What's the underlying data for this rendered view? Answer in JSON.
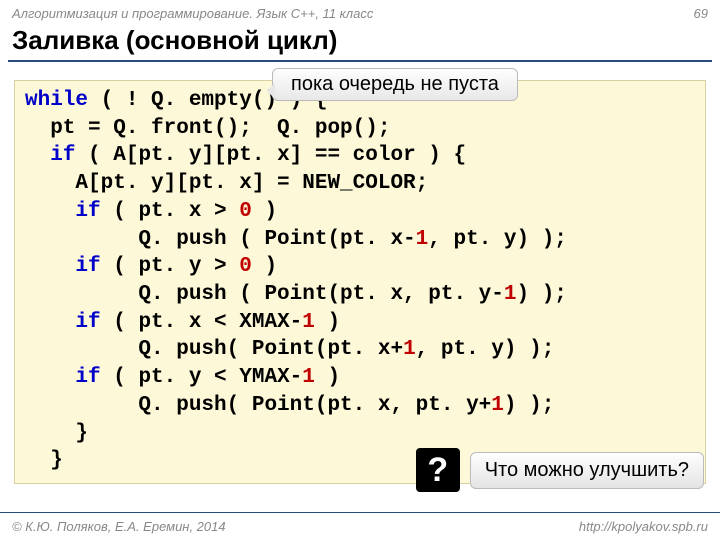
{
  "header": {
    "course": "Алгоритмизация и программирование. Язык C++, 11 класс",
    "slide_num": "69"
  },
  "title": "Заливка (основной цикл)",
  "callout": "пока очередь не пуста",
  "code": {
    "l1a": "while",
    "l1b": " ( ! Q. empty() ) {",
    "l2": "  pt = Q. front();  Q. pop();",
    "l3a": "  ",
    "l3b": "if",
    "l3c": " ( A[pt. y][pt. x] == color ) {",
    "l4": "    A[pt. y][pt. x] = NEW_COLOR;",
    "l5a": "    ",
    "l5b": "if",
    "l5c": " ( pt. x > ",
    "l5d": "0",
    "l5e": " )",
    "l6a": "         Q. push ( Point(pt. x-",
    "l6b": "1",
    "l6c": ", pt. y) );",
    "l7a": "    ",
    "l7b": "if",
    "l7c": " ( pt. y > ",
    "l7d": "0",
    "l7e": " )",
    "l8a": "         Q. push ( Point(pt. x, pt. y-",
    "l8b": "1",
    "l8c": ") );",
    "l9a": "    ",
    "l9b": "if",
    "l9c": " ( pt. x < XMAX-",
    "l9d": "1",
    "l9e": " )",
    "l10a": "         Q. push( Point(pt. x+",
    "l10b": "1",
    "l10c": ", pt. y) );",
    "l11a": "    ",
    "l11b": "if",
    "l11c": " ( pt. y < YMAX-",
    "l11d": "1",
    "l11e": " )",
    "l12a": "         Q. push( Point(pt. x, pt. y+",
    "l12b": "1",
    "l12c": ") );",
    "l13": "    }",
    "l14": "  }"
  },
  "question": {
    "mark": "?",
    "text": "Что можно улучшить?"
  },
  "footer": {
    "copyright": "© К.Ю. Поляков, Е.А. Еремин, 2014",
    "url": "http://kpolyakov.spb.ru"
  }
}
